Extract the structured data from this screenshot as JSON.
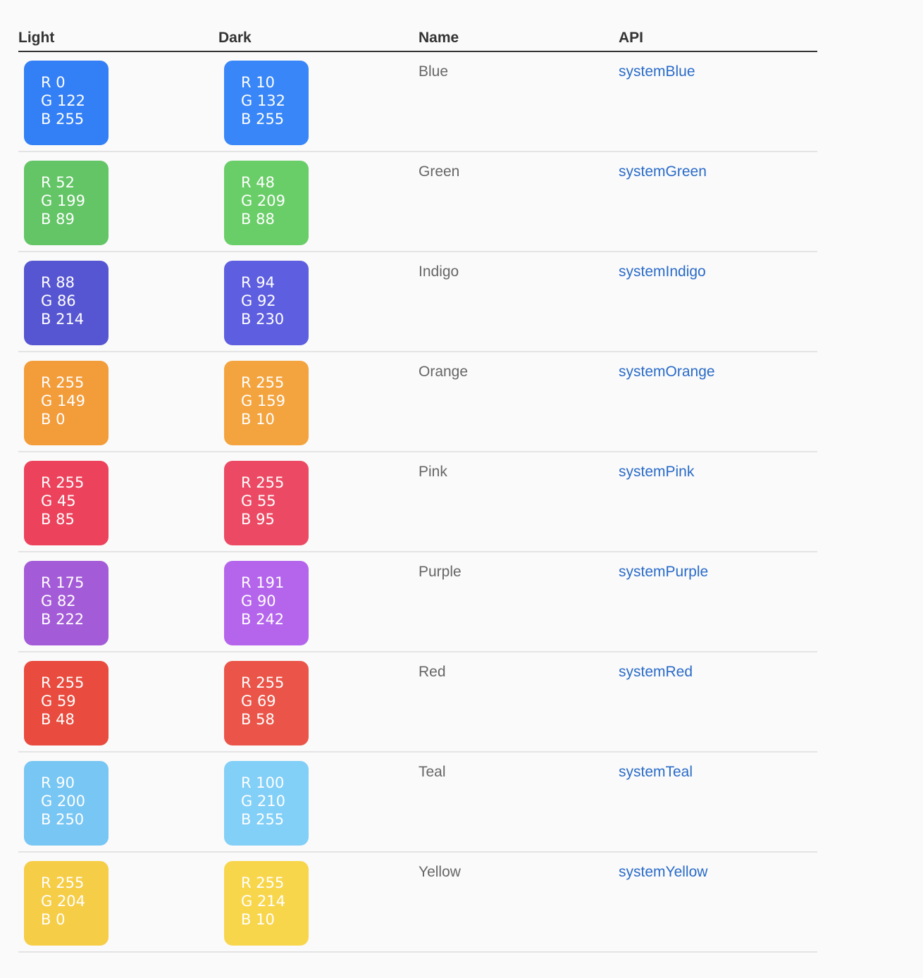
{
  "headers": {
    "light": "Light",
    "dark": "Dark",
    "name": "Name",
    "api": "API"
  },
  "rows": [
    {
      "name": "Blue",
      "api": "systemBlue",
      "light": {
        "r": "R 0",
        "g": "G 122",
        "b": "B 255",
        "color": "#337ff6"
      },
      "dark": {
        "r": "R 10",
        "g": "G 132",
        "b": "B 255",
        "color": "#3886f7"
      }
    },
    {
      "name": "Green",
      "api": "systemGreen",
      "light": {
        "r": "R 52",
        "g": "G 199",
        "b": "B 89",
        "color": "#63c566"
      },
      "dark": {
        "r": "R 48",
        "g": "G 209",
        "b": "B 88",
        "color": "#6ace68"
      }
    },
    {
      "name": "Indigo",
      "api": "systemIndigo",
      "light": {
        "r": "R 88",
        "g": "G 86",
        "b": "B 214",
        "color": "#5756d2"
      },
      "dark": {
        "r": "R 94",
        "g": "G 92",
        "b": "B 230",
        "color": "#5e5ee0"
      }
    },
    {
      "name": "Orange",
      "api": "systemOrange",
      "light": {
        "r": "R 255",
        "g": "G 149",
        "b": "B 0",
        "color": "#f39c3a"
      },
      "dark": {
        "r": "R 255",
        "g": "G 159",
        "b": "B 10",
        "color": "#f4a43e"
      }
    },
    {
      "name": "Pink",
      "api": "systemPink",
      "light": {
        "r": "R 255",
        "g": "G 45",
        "b": "B 85",
        "color": "#ec425c"
      },
      "dark": {
        "r": "R 255",
        "g": "G 55",
        "b": "B 95",
        "color": "#ec4a64"
      }
    },
    {
      "name": "Purple",
      "api": "systemPurple",
      "light": {
        "r": "R 175",
        "g": "G 82",
        "b": "B 222",
        "color": "#a45bd8"
      },
      "dark": {
        "r": "R 191",
        "g": "G 90",
        "b": "B 242",
        "color": "#b465ec"
      }
    },
    {
      "name": "Red",
      "api": "systemRed",
      "light": {
        "r": "R 255",
        "g": "G 59",
        "b": "B 48",
        "color": "#e94b3e"
      },
      "dark": {
        "r": "R 255",
        "g": "G 69",
        "b": "B 58",
        "color": "#eb5448"
      }
    },
    {
      "name": "Teal",
      "api": "systemTeal",
      "light": {
        "r": "R 90",
        "g": "G 200",
        "b": "B 250",
        "color": "#78c6f3"
      },
      "dark": {
        "r": "R 100",
        "g": "G 210",
        "b": "B 255",
        "color": "#82cff7"
      }
    },
    {
      "name": "Yellow",
      "api": "systemYellow",
      "light": {
        "r": "R 255",
        "g": "G 204",
        "b": "B 0",
        "color": "#f6cd47"
      },
      "dark": {
        "r": "R 255",
        "g": "G 214",
        "b": "B 10",
        "color": "#f8d64c"
      }
    }
  ]
}
